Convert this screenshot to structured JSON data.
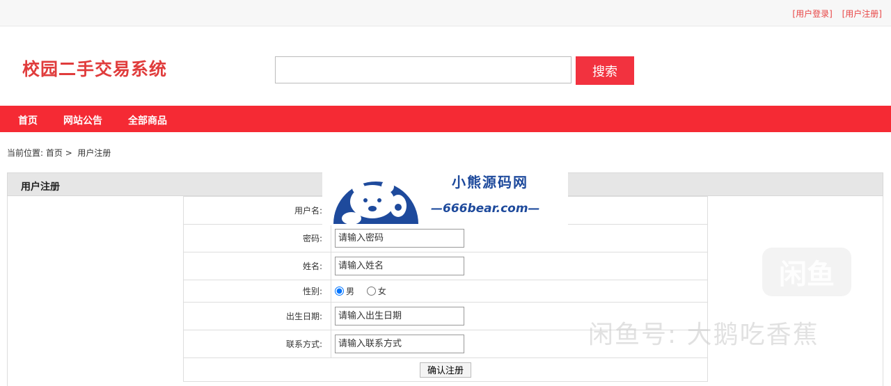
{
  "topbar": {
    "login": "[用户登录]",
    "register": "[用户注册]"
  },
  "header": {
    "title": "校园二手交易系统",
    "search_button": "搜索",
    "search_value": ""
  },
  "nav": [
    "首页",
    "网站公告",
    "全部商品"
  ],
  "breadcrumb": {
    "prefix": "当前位置:",
    "home": "首页",
    "sep": ">",
    "current": "用户注册"
  },
  "panel": {
    "title": "用户注册"
  },
  "form": {
    "username": {
      "label": "用户名:"
    },
    "password": {
      "label": "密码:",
      "placeholder": "请输入密码"
    },
    "name": {
      "label": "姓名:",
      "placeholder": "请输入姓名"
    },
    "gender": {
      "label": "性别:",
      "options": [
        "男",
        "女"
      ],
      "selected": "男"
    },
    "birthday": {
      "label": "出生日期:",
      "placeholder": "请输入出生日期"
    },
    "contact": {
      "label": "联系方式:",
      "placeholder": "请输入联系方式"
    },
    "submit": "确认注册"
  },
  "watermark": {
    "site_name": "小熊源码网",
    "site_url": "—666bear.com—",
    "app_icon_text": "闲鱼",
    "app_text": "闲鱼号: 大鹅吃香蕉"
  },
  "colors": {
    "accent": "#f52a34",
    "title": "#e03c3c",
    "watermark": "#1e4a9c"
  }
}
